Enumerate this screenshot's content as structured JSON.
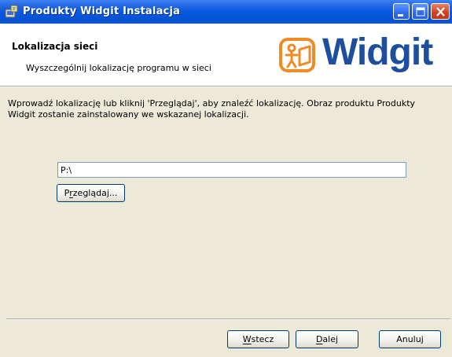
{
  "window": {
    "title": "Produkty Widgit Instalacja",
    "controls": {
      "minimize_icon": "minimize-icon",
      "maximize_icon": "maximize-icon",
      "close_icon": "close-icon"
    }
  },
  "banner": {
    "title": "Lokalizacja sieci",
    "subtitle": "Wyszczególnij lokalizację programu w sieci",
    "logo_text": "Widgit",
    "logo_color": "#1d4f9e",
    "logo_mark_color": "#f08a24"
  },
  "body": {
    "instruction": "Wprowadź lokalizację lub kliknij 'Przeglądaj', aby znaleźć lokalizację. Obraz produktu Produkty Widgit zostanie zainstalowany we wskazanej lokalizacji.",
    "path_value": "P:\\",
    "browse": {
      "mnemonic_pre": "P",
      "mnemonic": "r",
      "rest": "zeglądaj..."
    }
  },
  "footer": {
    "back": {
      "mnemonic": "W",
      "rest": "stecz"
    },
    "next": {
      "mnemonic": "D",
      "rest": "alej"
    },
    "cancel": {
      "label": "Anuluj"
    }
  }
}
